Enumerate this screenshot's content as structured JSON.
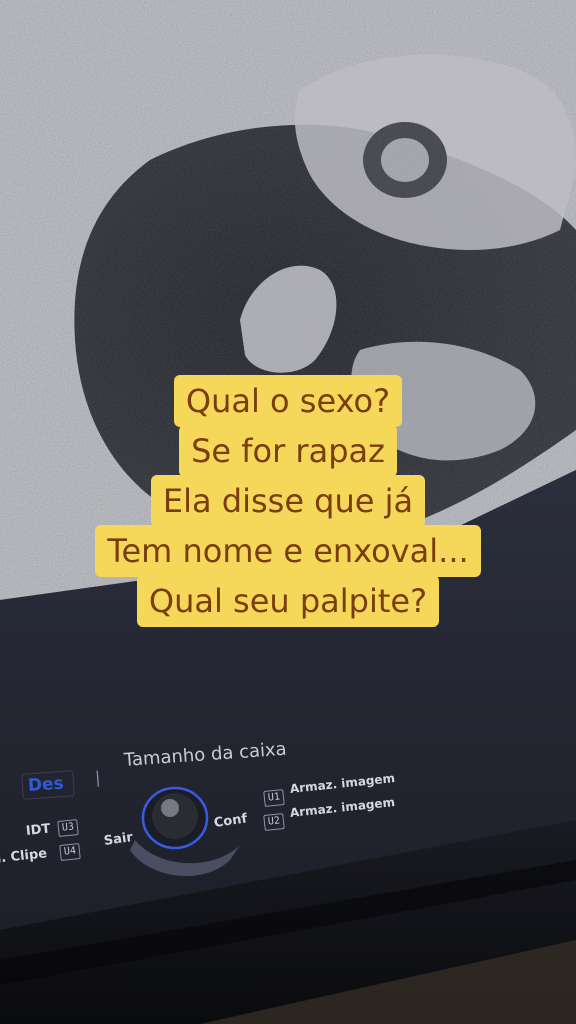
{
  "caption": {
    "lines": [
      "Qual o sexo?",
      "Se for rapaz",
      "Ela disse que já",
      "Tem nome e enxoval...",
      "Qual seu palpite?"
    ],
    "background_color": "#f5d85a",
    "text_color": "#7a3d0c"
  },
  "ultrasound_panel": {
    "tab_active": "Des",
    "separator": "|",
    "tab_label": "Tamanho da caixa",
    "buttons": {
      "idt": "IDT",
      "idt_key": "U3",
      "clipe": "n. Clipe",
      "clipe_key": "U4",
      "sair": "Sair",
      "conf": "Conf",
      "armaz_1_key": "U1",
      "armaz_1": "Armaz. imagem",
      "armaz_2_key": "U2",
      "armaz_2": "Armaz. imagem"
    },
    "trackball_icon": "trackball-icon"
  }
}
